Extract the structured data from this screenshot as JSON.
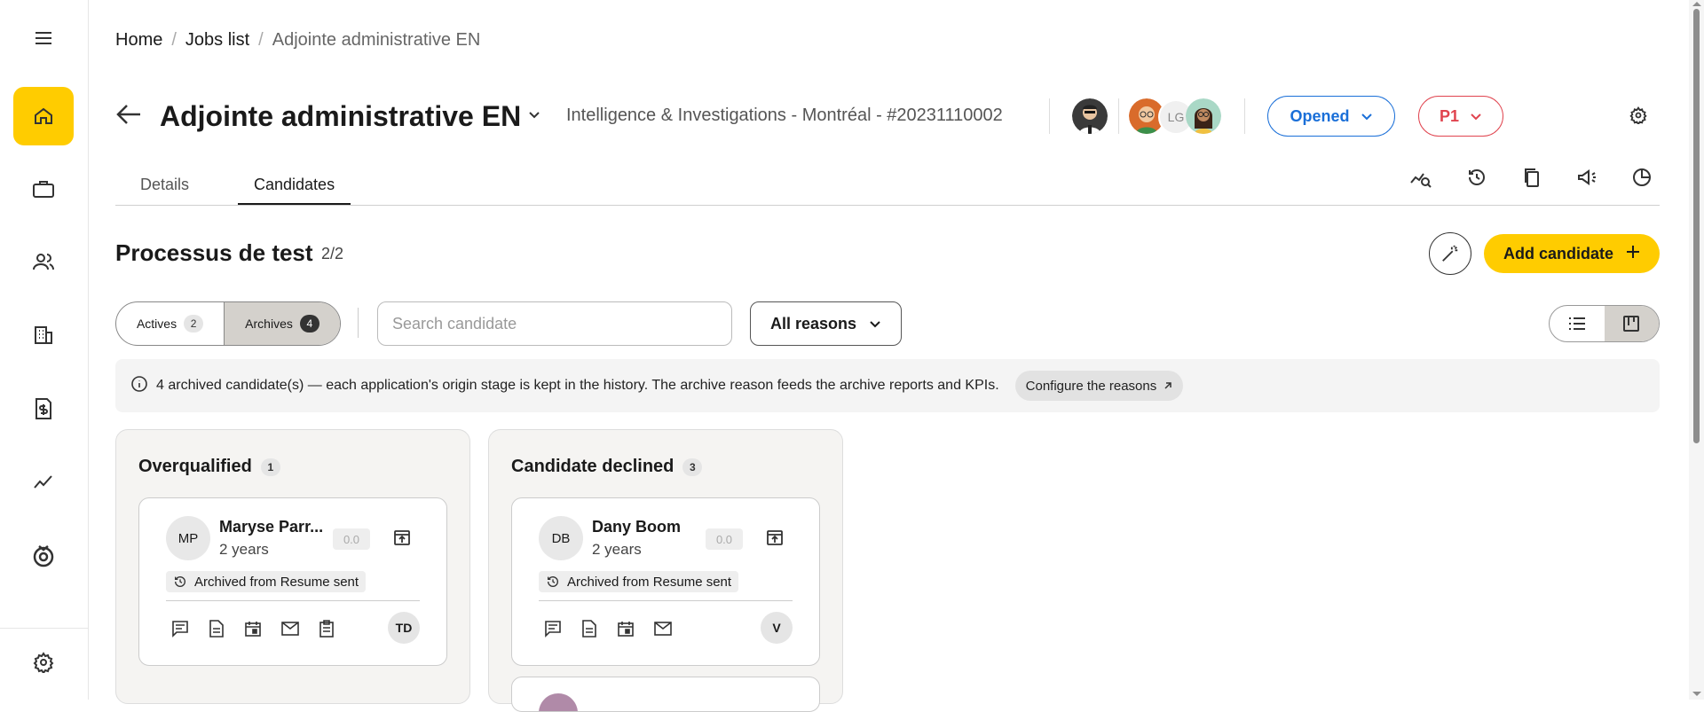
{
  "breadcrumb": {
    "home": "Home",
    "jobs": "Jobs list",
    "current": "Adjointe administrative EN"
  },
  "job": {
    "title": "Adjointe administrative EN",
    "subtitle": "Intelligence & Investigations - Montréal - #20231110002",
    "team_initials": "LG",
    "status": "Opened",
    "priority": "P1"
  },
  "tabs": {
    "details": "Details",
    "candidates": "Candidates"
  },
  "process": {
    "title": "Processus de test",
    "count": "2/2",
    "add_candidate": "Add candidate"
  },
  "filters": {
    "actives_label": "Actives",
    "actives_count": "2",
    "archives_label": "Archives",
    "archives_count": "4",
    "search_placeholder": "Search candidate",
    "reasons": "All reasons"
  },
  "info": {
    "text": "4 archived candidate(s) — each application's origin stage is kept in the history. The archive reason feeds the archive reports and KPIs.",
    "link": "Configure the reasons"
  },
  "columns": [
    {
      "title": "Overqualified",
      "count": "1",
      "card": {
        "initials": "MP",
        "name": "Maryse Parr...",
        "experience": "2 years",
        "score": "0.0",
        "archived": "Archived from Resume sent",
        "owner": "TD"
      }
    },
    {
      "title": "Candidate declined",
      "count": "3",
      "card": {
        "initials": "DB",
        "name": "Dany Boom",
        "experience": "2 years",
        "score": "0.0",
        "archived": "Archived from Resume sent",
        "owner": "V"
      }
    }
  ],
  "colors": {
    "accent": "#ffcc00",
    "status_blue": "#1a6fd8",
    "priority_red": "#e0444f"
  }
}
